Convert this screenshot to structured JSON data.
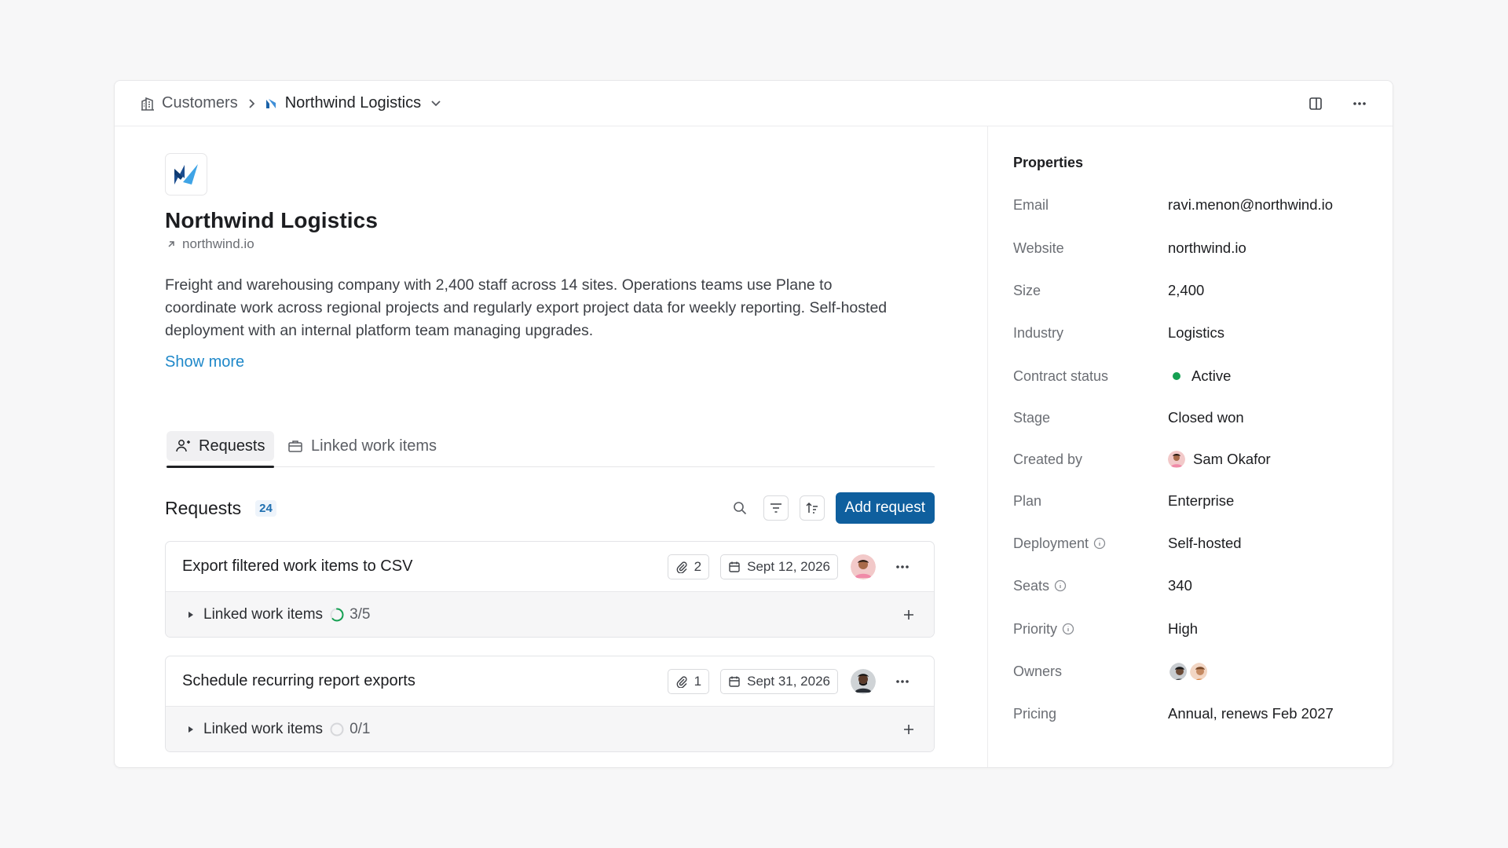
{
  "breadcrumb": {
    "parent": "Customers",
    "current": "Northwind Logistics"
  },
  "company": {
    "name": "Northwind Logistics",
    "domain": "northwind.io",
    "description": "Freight and warehousing company with 2,400 staff across 14 sites. Operations teams use Plane to coordinate work across regional projects and regularly export project data for weekly reporting. Self-hosted deployment with an internal platform team managing upgrades.",
    "show_more": "Show more"
  },
  "tabs": [
    {
      "label": "Requests",
      "active": true
    },
    {
      "label": "Linked work items",
      "active": false
    }
  ],
  "requests": {
    "title": "Requests",
    "count": "24",
    "add_label": "Add request",
    "items": [
      {
        "name": "Export filtered work items to CSV",
        "attachments": "2",
        "date": "Sept 12, 2026",
        "linked_label": "Linked work items",
        "progress": "3/5",
        "progress_fraction": 0.6
      },
      {
        "name": "Schedule recurring report exports",
        "attachments": "1",
        "date": "Sept 31, 2026",
        "linked_label": "Linked work items",
        "progress": "0/1",
        "progress_fraction": 0
      }
    ]
  },
  "properties": {
    "title": "Properties",
    "rows": [
      {
        "label": "Email",
        "value": "ravi.menon@northwind.io"
      },
      {
        "label": "Website",
        "value": "northwind.io"
      },
      {
        "label": "Size",
        "value": "2,400"
      },
      {
        "label": "Industry",
        "value": "Logistics"
      },
      {
        "label": "Contract status",
        "value": "Active"
      },
      {
        "label": "Stage",
        "value": "Closed won"
      },
      {
        "label": "Created by",
        "value": "Sam Okafor"
      },
      {
        "label": "Plan",
        "value": "Enterprise"
      },
      {
        "label": "Deployment",
        "value": "Self-hosted"
      },
      {
        "label": "Seats",
        "value": "340"
      },
      {
        "label": "Priority",
        "value": "High"
      },
      {
        "label": "Owners",
        "value": ""
      },
      {
        "label": "Pricing",
        "value": "Annual, renews Feb 2027"
      }
    ]
  },
  "colors": {
    "accent": "#0f5f9e",
    "link": "#1f88c9",
    "status_active": "#15a052",
    "progress": "#15a052"
  },
  "icons": {
    "breadcrumb_parent": "building-icon",
    "breadcrumb_current": "company-logo-icon",
    "sidebar_toggle": "panel-right-icon",
    "more": "more-horizontal-icon"
  }
}
